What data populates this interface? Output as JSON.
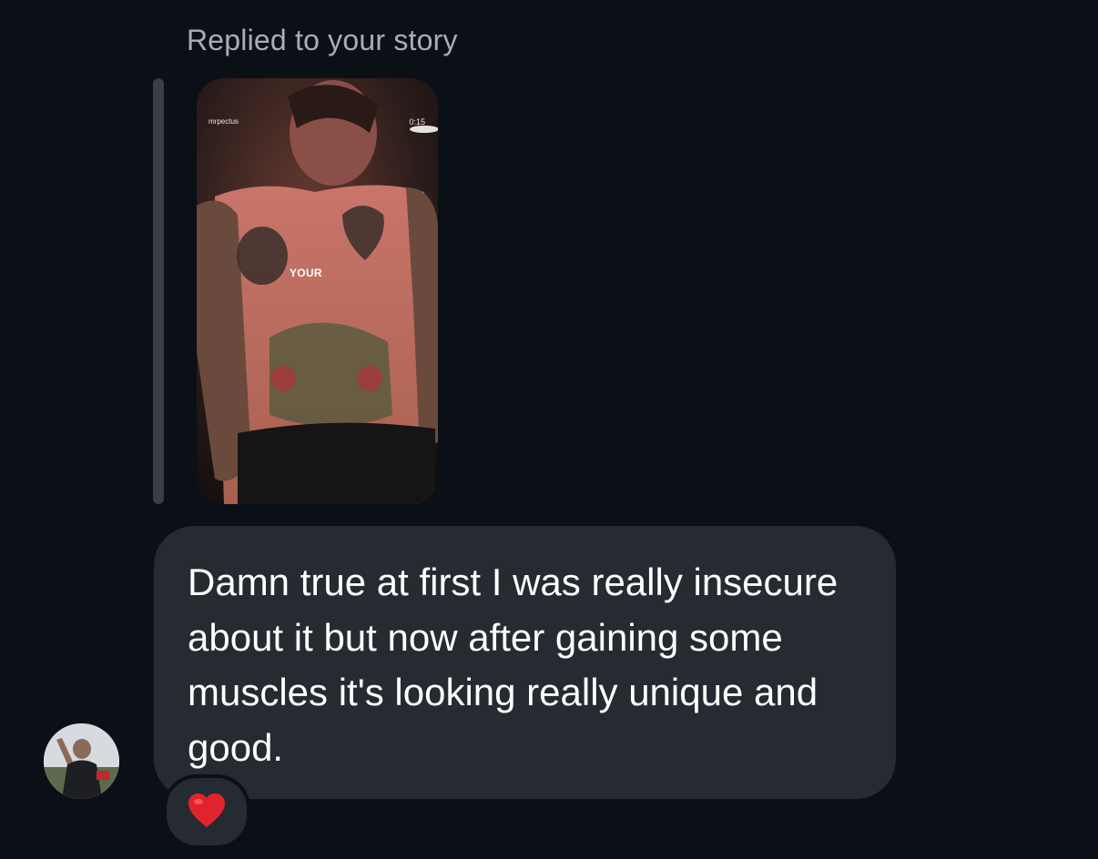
{
  "reply_header": {
    "label": "Replied to your story"
  },
  "story": {
    "username": "mrpectus",
    "duration": "0:15",
    "overlay_text": "YOUR"
  },
  "message": {
    "text": "Damn true at first I was really insecure about it but now after gaining some muscles it's looking really unique and good.",
    "reaction_icon": "red-heart-emoji"
  },
  "sender": {
    "avatar_icon": "profile-photo"
  },
  "colors": {
    "background": "#0b0f16",
    "bubble": "#262a31",
    "muted_text": "#a9adb5",
    "reaction_heart": "#e0242e"
  }
}
